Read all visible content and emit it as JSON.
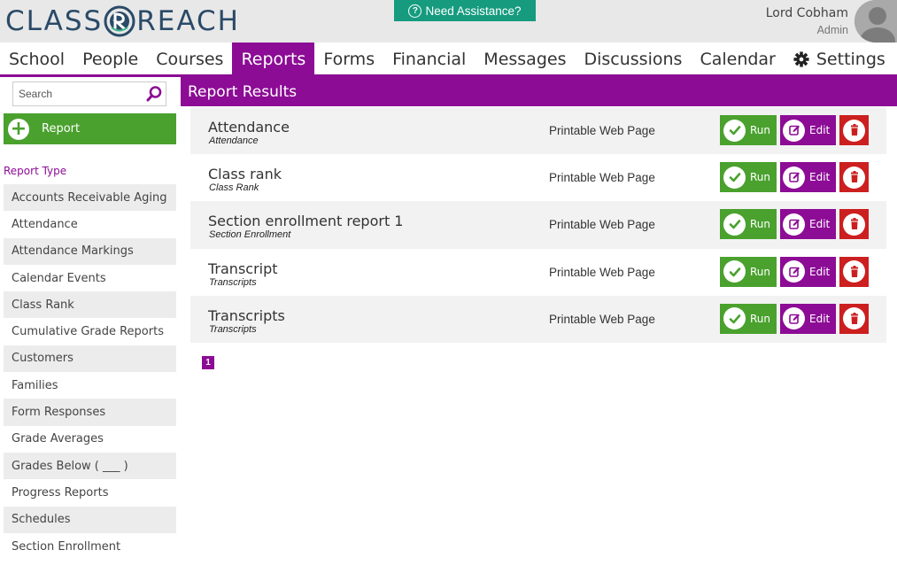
{
  "header": {
    "logo_left": "CLASS",
    "logo_right": "REACH",
    "assist_label": "Need Assistance?",
    "user_name": "Lord Cobham",
    "user_role": "Admin"
  },
  "nav": {
    "items": [
      {
        "label": "School"
      },
      {
        "label": "People"
      },
      {
        "label": "Courses"
      },
      {
        "label": "Reports"
      },
      {
        "label": "Forms"
      },
      {
        "label": "Financial"
      },
      {
        "label": "Messages"
      },
      {
        "label": "Discussions"
      },
      {
        "label": "Calendar"
      },
      {
        "label": "Settings"
      }
    ],
    "active": "Reports"
  },
  "sidebar": {
    "search_placeholder": "Search",
    "add_report_label": "Report",
    "report_type_heading": "Report Type",
    "types": [
      "Accounts Receivable Aging",
      "Attendance",
      "Attendance Markings",
      "Calendar Events",
      "Class Rank",
      "Cumulative Grade Reports",
      "Customers",
      "Families",
      "Form Responses",
      "Grade Averages",
      "Grades Below ( ___ )",
      "Progress Reports",
      "Schedules",
      "Section Enrollment"
    ]
  },
  "main": {
    "title": "Report Results",
    "run_label": "Run",
    "edit_label": "Edit",
    "reports": [
      {
        "name": "Attendance",
        "type": "Attendance",
        "format": "Printable Web Page"
      },
      {
        "name": "Class rank",
        "type": "Class Rank",
        "format": "Printable Web Page"
      },
      {
        "name": "Section enrollment report 1",
        "type": "Section Enrollment",
        "format": "Printable Web Page"
      },
      {
        "name": "Transcript",
        "type": "Transcripts",
        "format": "Printable Web Page"
      },
      {
        "name": "Transcripts",
        "type": "Transcripts",
        "format": "Printable Web Page"
      }
    ],
    "page": "1"
  },
  "colors": {
    "purple": "#8c0c95",
    "green": "#4aa12e",
    "red": "#cc1f1f",
    "teal": "#169b7f",
    "logo": "#2a4a68"
  }
}
